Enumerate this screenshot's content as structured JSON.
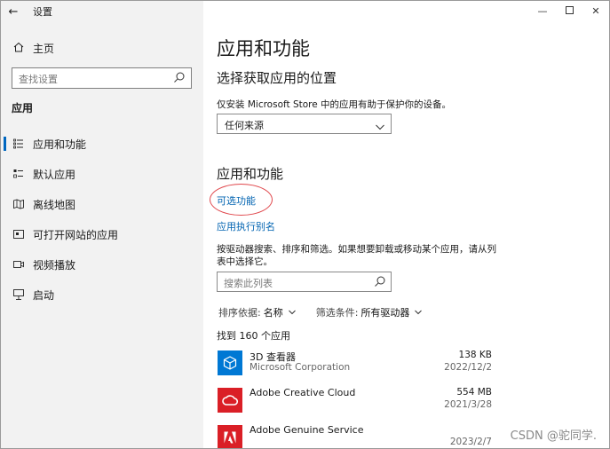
{
  "window": {
    "app_title": "设置"
  },
  "sidebar": {
    "home_label": "主页",
    "search_placeholder": "查找设置",
    "section_label": "应用",
    "items": [
      {
        "label": "应用和功能",
        "icon": "apps-list-icon",
        "active": true
      },
      {
        "label": "默认应用",
        "icon": "default-apps-icon",
        "active": false
      },
      {
        "label": "离线地图",
        "icon": "offline-map-icon",
        "active": false
      },
      {
        "label": "可打开网站的应用",
        "icon": "open-website-icon",
        "active": false
      },
      {
        "label": "视频播放",
        "icon": "video-playback-icon",
        "active": false
      },
      {
        "label": "启动",
        "icon": "startup-icon",
        "active": false
      }
    ]
  },
  "main": {
    "page_title": "应用和功能",
    "source_section_title": "选择获取应用的位置",
    "source_description": "仅安装 Microsoft Store 中的应用有助于保护你的设备。",
    "source_dropdown_value": "任何来源",
    "apps_section_title": "应用和功能",
    "optional_features_link": "可选功能",
    "app_execution_alias_link": "应用执行别名",
    "search_description": "按驱动器搜索、排序和筛选。如果想要卸载或移动某个应用，请从列表中选择它。",
    "search_placeholder": "搜索此列表",
    "sort_label": "排序依据:",
    "sort_value": "名称",
    "filter_label": "筛选条件:",
    "filter_value": "所有驱动器",
    "found_count_text": "找到 160 个应用",
    "apps": [
      {
        "name": "3D 查看器",
        "publisher": "Microsoft Corporation",
        "size": "138 KB",
        "date": "2022/12/2",
        "icon": "3d-viewer-icon",
        "color": "#0078d4"
      },
      {
        "name": "Adobe Creative Cloud",
        "publisher": "",
        "size": "554 MB",
        "date": "2021/3/28",
        "icon": "creative-cloud-icon",
        "color": "#da1f26"
      },
      {
        "name": "Adobe Genuine Service",
        "publisher": "",
        "size": "",
        "date": "2023/2/7",
        "icon": "adobe-icon",
        "color": "#da1f26"
      }
    ]
  },
  "colors": {
    "accent": "#0067c0",
    "link": "#0063b1",
    "highlight_circle": "#e0474c",
    "sidebar_bg": "#f2f2f2"
  },
  "watermark": "CSDN @驼同学."
}
